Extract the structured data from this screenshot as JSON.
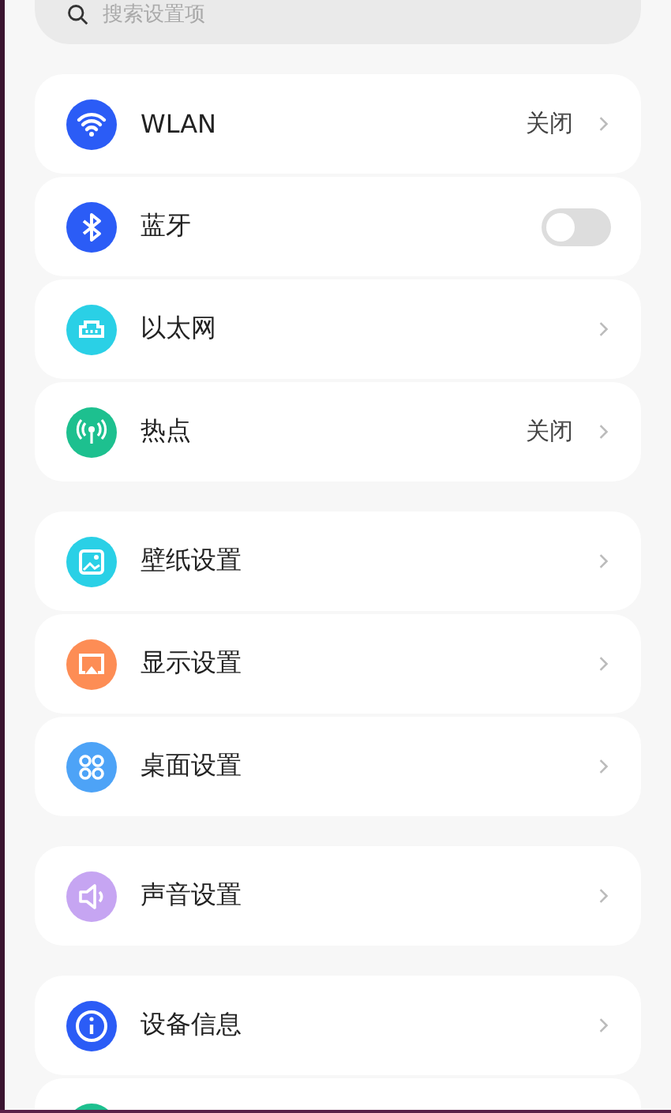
{
  "search": {
    "placeholder": "搜索设置项"
  },
  "groups": [
    {
      "items": [
        {
          "kind": "value",
          "label": "WLAN",
          "value": "关闭",
          "color": "#2b5cf6"
        },
        {
          "kind": "toggle",
          "label": "蓝牙",
          "on": false,
          "color": "#2b5cf6"
        },
        {
          "kind": "link",
          "label": "以太网",
          "color": "#2ad0e6"
        },
        {
          "kind": "value",
          "label": "热点",
          "value": "关闭",
          "color": "#1dc08f"
        }
      ]
    },
    {
      "items": [
        {
          "kind": "link",
          "label": "壁纸设置",
          "color": "#2ad0e6"
        },
        {
          "kind": "link",
          "label": "显示设置",
          "color": "#fd8d55"
        },
        {
          "kind": "link",
          "label": "桌面设置",
          "color": "#4da3f7"
        }
      ]
    },
    {
      "items": [
        {
          "kind": "link",
          "label": "声音设置",
          "color": "#c6a5f2"
        }
      ]
    },
    {
      "items": [
        {
          "kind": "link",
          "label": "设备信息",
          "color": "#2b5cf6"
        },
        {
          "kind": "partial",
          "color": "#1dc08f"
        }
      ]
    }
  ]
}
